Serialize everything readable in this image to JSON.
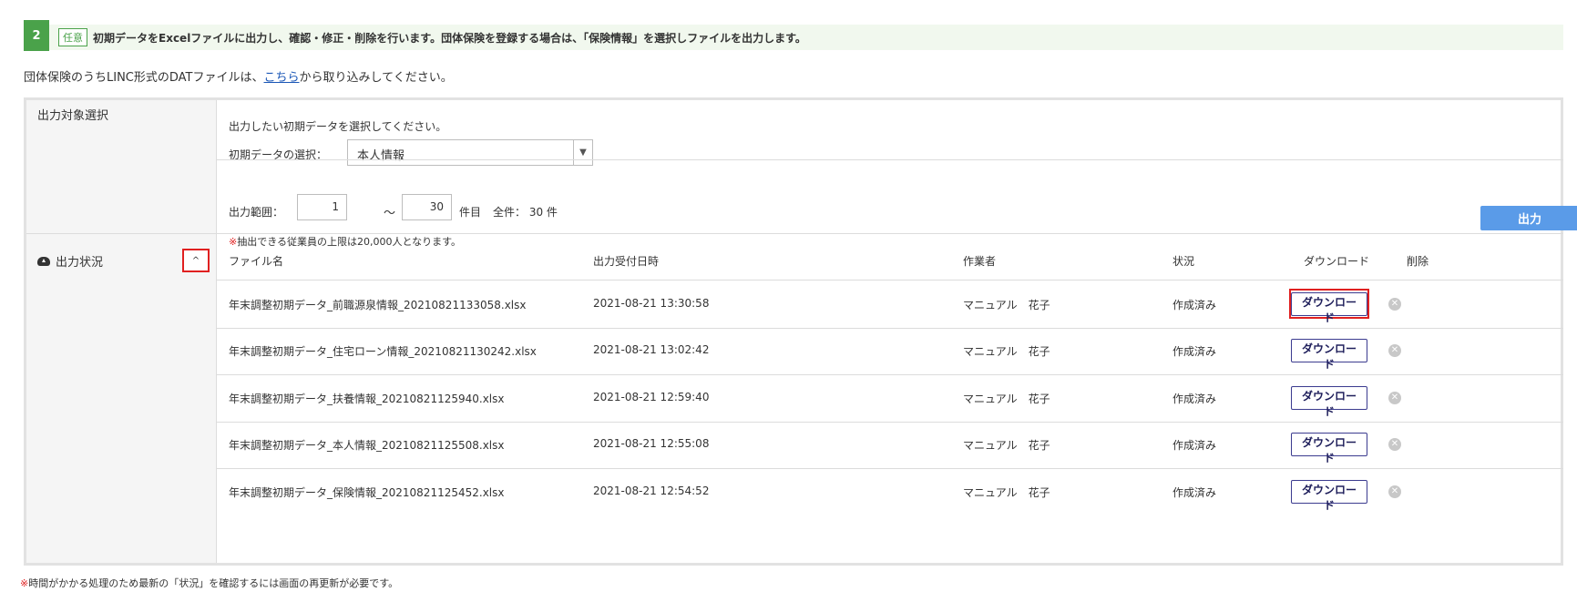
{
  "step": {
    "number": "2",
    "tag": "任意",
    "text": "初期データをExcelファイルに出力し、確認・修正・削除を行います。団体保険を登録する場合は、「保険情報」を選択しファイルを出力します。"
  },
  "lead": {
    "before": "団体保険のうちLINC形式のDATファイルは、",
    "link": "こちら",
    "after": "から取り込みしてください。"
  },
  "output_select": {
    "label": "出力対象選択",
    "description": "出力したい初期データを選択してください。",
    "select_label": "初期データの選択：",
    "select_value": "本人情報"
  },
  "range": {
    "label": "出力範囲：",
    "from": "1",
    "tilde": "～",
    "to": "30",
    "unit": "件目",
    "total": "全件： 30 件",
    "note_mark": "※",
    "note": "抽出できる従業員の上限は20,000人となります。",
    "button": "出力"
  },
  "status": {
    "label": "出力状況",
    "toggle": "^",
    "headers": {
      "file": "ファイル名",
      "date": "出力受付日時",
      "worker": "作業者",
      "state": "状況",
      "download": "ダウンロード",
      "delete": "削除"
    },
    "rows": [
      {
        "file": "年末調整初期データ_前職源泉情報_20210821133058.xlsx",
        "date": "2021-08-21 13:30:58",
        "worker": "マニュアル　花子",
        "state": "作成済み",
        "button": "ダウンロード"
      },
      {
        "file": "年末調整初期データ_住宅ローン情報_20210821130242.xlsx",
        "date": "2021-08-21 13:02:42",
        "worker": "マニュアル　花子",
        "state": "作成済み",
        "button": "ダウンロード"
      },
      {
        "file": "年末調整初期データ_扶養情報_20210821125940.xlsx",
        "date": "2021-08-21 12:59:40",
        "worker": "マニュアル　花子",
        "state": "作成済み",
        "button": "ダウンロード"
      },
      {
        "file": "年末調整初期データ_本人情報_20210821125508.xlsx",
        "date": "2021-08-21 12:55:08",
        "worker": "マニュアル　花子",
        "state": "作成済み",
        "button": "ダウンロード"
      },
      {
        "file": "年末調整初期データ_保険情報_20210821125452.xlsx",
        "date": "2021-08-21 12:54:52",
        "worker": "マニュアル　花子",
        "state": "作成済み",
        "button": "ダウンロード"
      }
    ]
  },
  "footnote": {
    "mark": "※",
    "text": "時間がかかる処理のため最新の「状況」を確認するには画面の再更新が必要です。"
  }
}
